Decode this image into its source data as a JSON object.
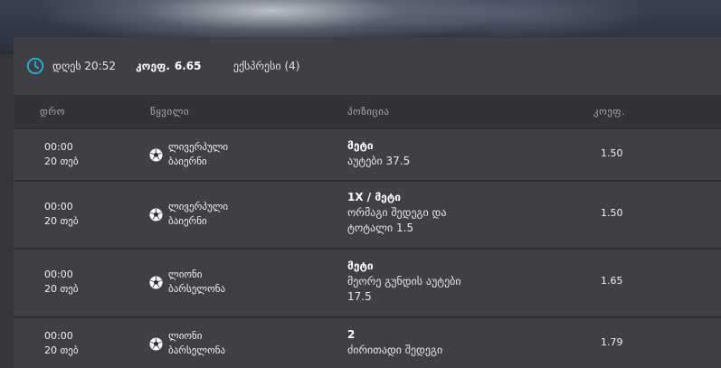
{
  "summary": {
    "date": "დღეს 20:52",
    "coef_label": "კოეფ.",
    "coef_value": "6.65",
    "express": "ექსპრესი (4)"
  },
  "columns": {
    "time": "დრო",
    "event": "წყვილი",
    "position": "პოზიცია",
    "coef": "კოეფ."
  },
  "rows": [
    {
      "time": "00:00",
      "date": "20 თებ",
      "team1": "ლივერპული",
      "team2": "ბაიერნი",
      "pos_title": "მეტი",
      "pos_desc": [
        "აუტები 37.5"
      ],
      "coef": "1.50"
    },
    {
      "time": "00:00",
      "date": "20 თებ",
      "team1": "ლივერპული",
      "team2": "ბაიერნი",
      "pos_title": "1X / მეტი",
      "pos_desc": [
        "ორმაგი შედეგი და",
        "ტოტალი 1.5"
      ],
      "coef": "1.50"
    },
    {
      "time": "00:00",
      "date": "20 თებ",
      "team1": "ლიონი",
      "team2": "ბარსელონა",
      "pos_title": "მეტი",
      "pos_desc": [
        "მეორე გუნდის აუტები",
        "17.5"
      ],
      "coef": "1.65"
    },
    {
      "time": "00:00",
      "date": "20 თებ",
      "team1": "ლიონი",
      "team2": "ბარსელონა",
      "pos_title": "2",
      "pos_desc": [
        "ძირითადი შედეგი"
      ],
      "coef": "1.79"
    }
  ],
  "colors": {
    "clock": "#1fb6d6",
    "panel": "#3e4046",
    "header": "#313338"
  },
  "icons": {
    "clock": "clock-icon",
    "ball": "soccer-ball-icon"
  }
}
